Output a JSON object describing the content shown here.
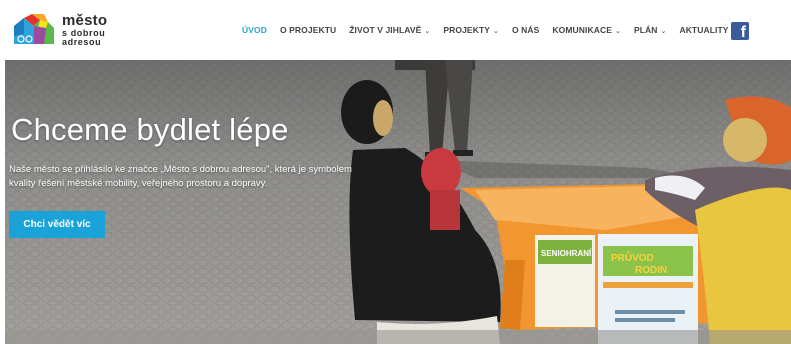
{
  "logo": {
    "line1": "město",
    "line2": "s dobrou",
    "line3": "adresou"
  },
  "nav": {
    "items": [
      {
        "label": "ÚVOD",
        "active": true,
        "dropdown": false
      },
      {
        "label": "O PROJEKTU",
        "active": false,
        "dropdown": false
      },
      {
        "label": "ŽIVOT V JIHLAVĚ",
        "active": false,
        "dropdown": true
      },
      {
        "label": "PROJEKTY",
        "active": false,
        "dropdown": true
      },
      {
        "label": "O NÁS",
        "active": false,
        "dropdown": false
      },
      {
        "label": "KOMUNIKACE",
        "active": false,
        "dropdown": true
      },
      {
        "label": "PLÁN",
        "active": false,
        "dropdown": true
      },
      {
        "label": "AKTUALITY",
        "active": false,
        "dropdown": false
      }
    ],
    "chevron": "⌄",
    "facebook_glyph": "f"
  },
  "hero": {
    "title": "Chceme bydlet lépe",
    "description": "Naše město se přihlásilo ke značce „Město s dobrou adresou\", která je symbolem kvality řešení městské mobility, veřejného prostoru a dopravy.",
    "button_label": "Chci vědět víc",
    "poster_left": "SENIOHRANÍ",
    "poster_right_1": "PRŮVOD",
    "poster_right_2": "RODIN"
  },
  "colors": {
    "accent": "#1aa3d9",
    "active_nav": "#29a5d8",
    "facebook": "#3b5b9a",
    "tablecloth": "#f2962f"
  }
}
